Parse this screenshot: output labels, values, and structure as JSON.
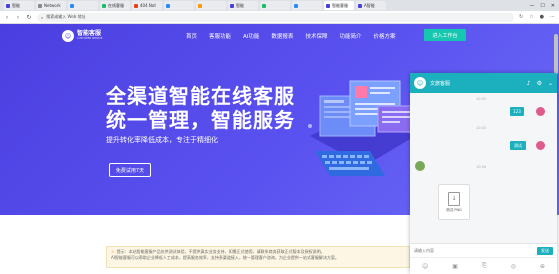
{
  "browser": {
    "tabs": [
      {
        "label": "智能",
        "color": "#4b3ee0",
        "active": false
      },
      {
        "label": "Network",
        "color": "#888888",
        "active": false
      },
      {
        "label": "",
        "color": "#2d8cf0",
        "active": false
      },
      {
        "label": "在线客服",
        "color": "#19be6b",
        "active": false
      },
      {
        "label": "404 Not",
        "color": "#ed4014",
        "active": false
      },
      {
        "label": "",
        "color": "#2d8cf0",
        "active": false
      },
      {
        "label": "",
        "color": "#ff9900",
        "active": false
      },
      {
        "label": "智能",
        "color": "#4b3ee0",
        "active": false
      },
      {
        "label": "",
        "color": "#19be6b",
        "active": false
      },
      {
        "label": "",
        "color": "#2d8cf0",
        "active": false
      },
      {
        "label": "智能客服",
        "color": "#4b3ee0",
        "active": true
      },
      {
        "label": "A智能",
        "color": "#4b3ee0",
        "active": false
      }
    ],
    "window_controls": {
      "min": "—",
      "max": "☐",
      "close": "✕"
    },
    "nav": {
      "back": "‹",
      "forward": "›",
      "reload": "↻"
    },
    "address_placeholder": "搜索或输入 Web 地址",
    "toolbar_icons": {
      "refresh": "↻",
      "star": "☆",
      "profile": "●",
      "menu": "⋯"
    }
  },
  "site": {
    "logo_name": "智能客服",
    "logo_sub": "CUSTOMER SERVICE",
    "menu": [
      "首页",
      "客服功能",
      "AI功能",
      "数据报表",
      "技术保障",
      "功能简介",
      "价格方案"
    ],
    "cta_top": "进入工作台",
    "headline_1": "全渠道智能在线客服",
    "headline_2": "统一管理，智能服务",
    "subline": "提升转化率降低成本，专注于精细化",
    "hero_button": "免费试用7天",
    "notice_warn": "⚠",
    "notice_line_1": "提示：本站智能客服产品仅供测试体验，不提供真实业务支持，如需正式使用，请联系商务获取正式版本及授权说明。",
    "notice_line_2": "AI智能客服可以帮助企业降低人工成本，提高服务效率，支持多渠道接入，统一管理客户咨询，为企业提供一站式客服解决方案。"
  },
  "chat": {
    "avatar": "☺",
    "title": "文旅客服",
    "ctrls": {
      "sound": "♪",
      "settings": "⚙",
      "collapse": "⌄"
    },
    "ts_1": "10:32",
    "bubble_1": "123",
    "ts_2": "10:33",
    "bubble_2": "测试",
    "ts_3": "10:34",
    "file_icon": "↓",
    "file_name": "测试.PNG",
    "input_placeholder": "请输入内容",
    "send": "发送",
    "tools": {
      "emoji": "☺",
      "image": "▣",
      "file": "⎘",
      "location": "◎",
      "more": "⊕"
    }
  },
  "colors": {
    "hero": "#4b3ee0",
    "chat_accent": "#1cb0bf",
    "cta": "#16c7b0"
  }
}
